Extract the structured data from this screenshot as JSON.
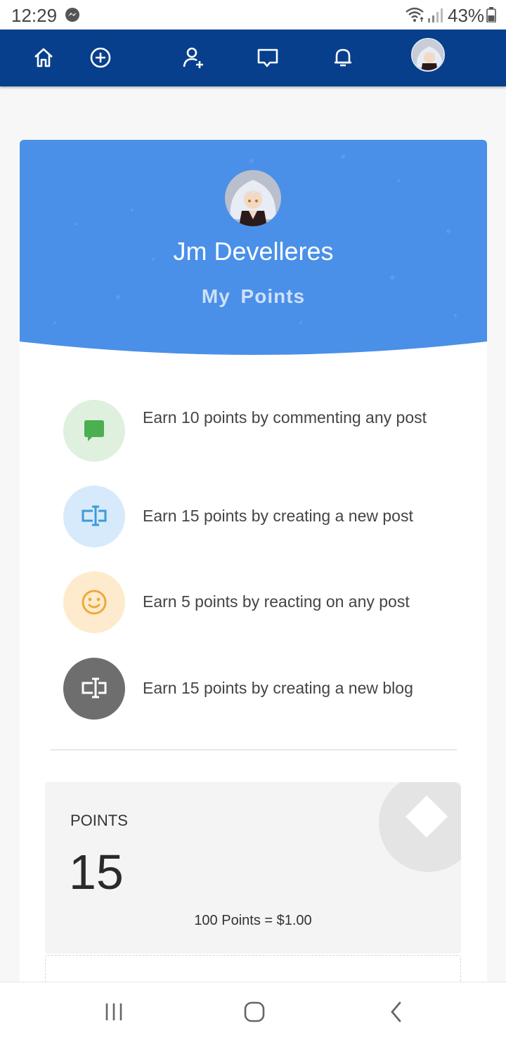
{
  "status_bar": {
    "time": "12:29",
    "battery": "43%",
    "icons": [
      "messenger-icon",
      "wifi-icon",
      "signal-icon",
      "battery-icon"
    ]
  },
  "top_nav": {
    "items": [
      "home-icon",
      "add-circle-icon",
      "add-user-icon",
      "message-icon",
      "bell-icon",
      "user-avatar"
    ],
    "background": "#073f8c"
  },
  "profile": {
    "name": "Jm Develleres",
    "page_title": "My Points",
    "header_color": "#4a90e8"
  },
  "earn_items": [
    {
      "text": "Earn 10 points by commenting any post",
      "icon": "comment-icon",
      "circle_color": "#dff0de",
      "icon_color": "#4caf50"
    },
    {
      "text": "Earn 15 points by creating a new post",
      "icon": "text-cursor-icon",
      "circle_color": "#d6eafb",
      "icon_color": "#3d9ad9"
    },
    {
      "text": "Earn 5 points by reacting on any post",
      "icon": "smiley-icon",
      "circle_color": "#feebcd",
      "icon_color": "#f0a83a"
    },
    {
      "text": "Earn 15 points by creating a new blog",
      "icon": "text-cursor-icon",
      "circle_color": "#6e6e6e",
      "icon_color": "#ffffff"
    }
  ],
  "points": {
    "label": "POINTS",
    "value": "15",
    "rate": "100 Points = $1.00"
  },
  "system_nav": [
    "recents-icon",
    "home-button-icon",
    "back-icon"
  ]
}
